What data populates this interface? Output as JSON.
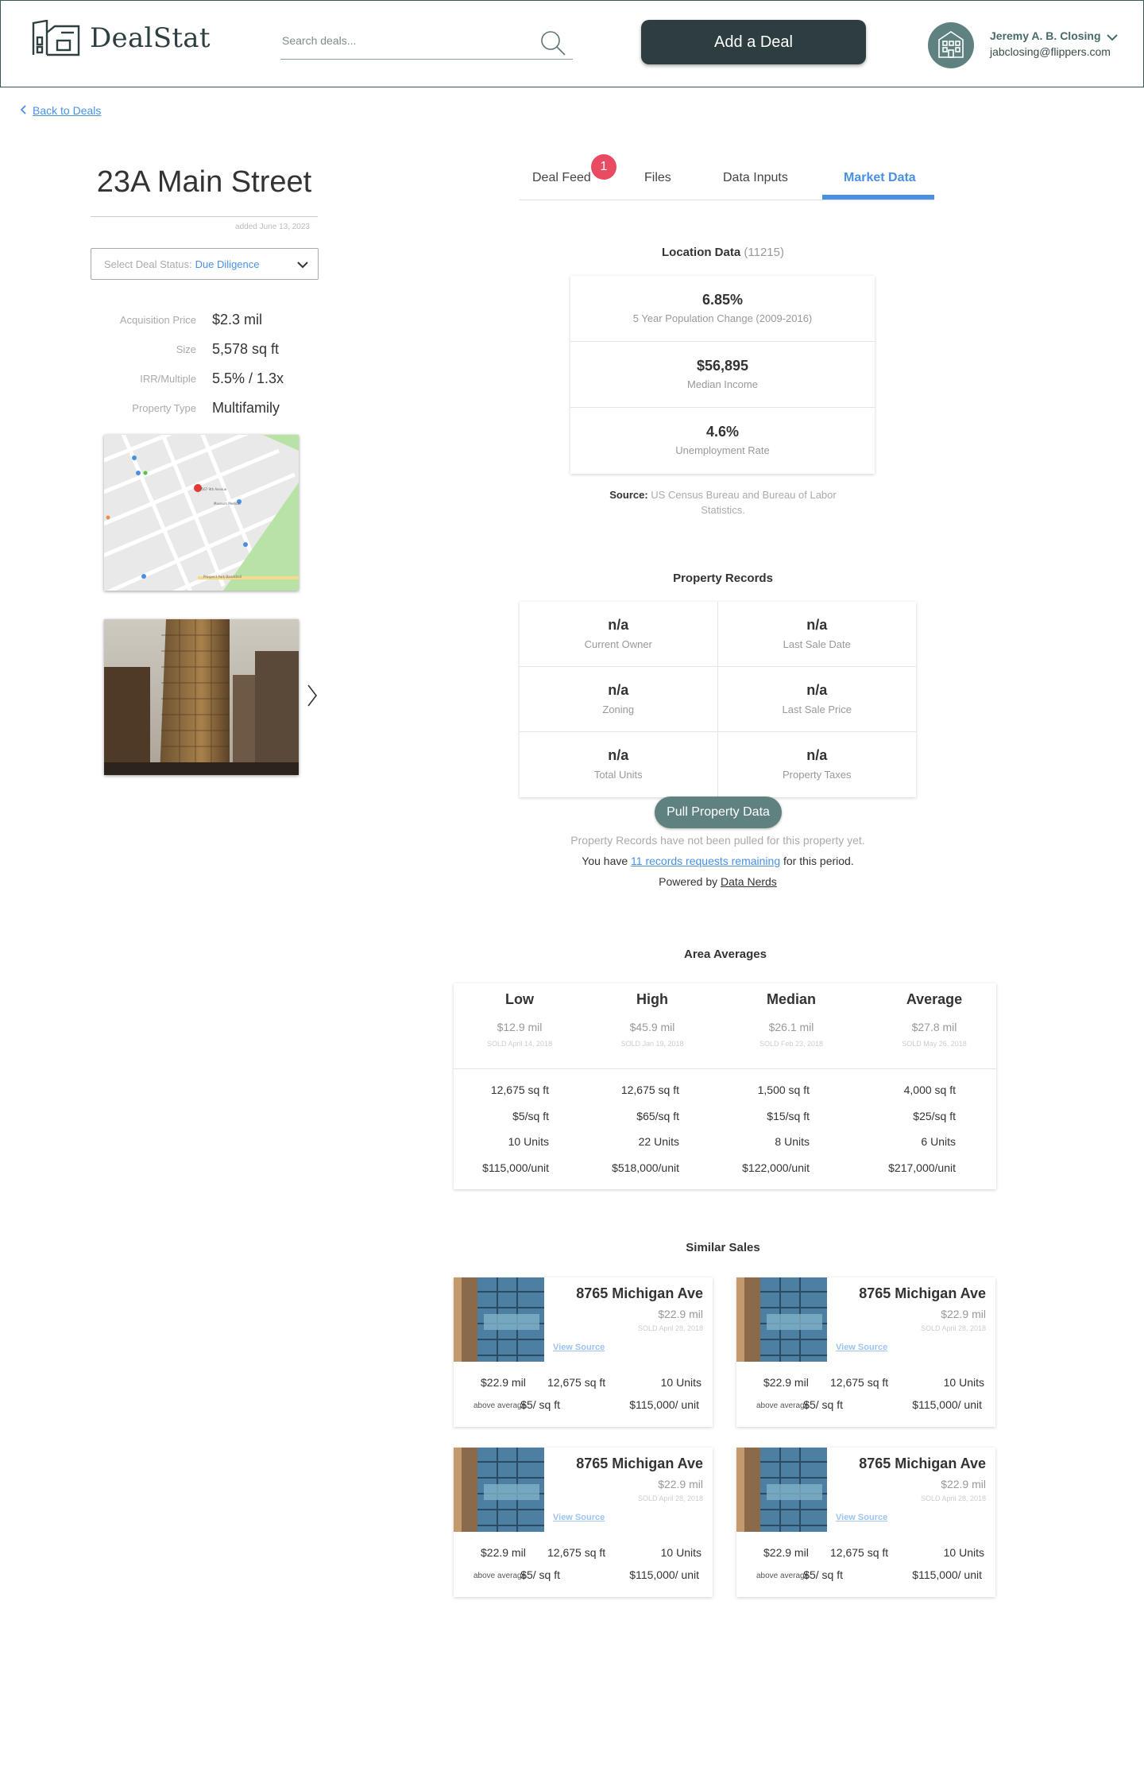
{
  "header": {
    "logo_text": "DealStat",
    "search_placeholder": "Search deals...",
    "add_deal_label": "Add a Deal",
    "user_name": "Jeremy A. B. Closing",
    "user_email": "jabclosing@flippers.com"
  },
  "nav": {
    "back_label": "Back to Deals"
  },
  "deal": {
    "title": "23A Main Street",
    "added": "added June 13, 2023",
    "status_label": "Select Deal Status:",
    "status_value": "Due Diligence",
    "properties": [
      {
        "label": "Acquisition Price",
        "value": "$2.3 mil"
      },
      {
        "label": "Size",
        "value": "5,578 sq ft"
      },
      {
        "label": "IRR/Multiple",
        "value": "5.5% / 1.3x"
      },
      {
        "label": "Property Type",
        "value": "Multifamily"
      }
    ]
  },
  "tabs": [
    {
      "label": "Deal Feed"
    },
    {
      "label": "Files"
    },
    {
      "label": "Data Inputs"
    },
    {
      "label": "Market Data"
    }
  ],
  "deal_feed_badge": "1",
  "location": {
    "title": "Location Data",
    "zip": "(11215)",
    "items": [
      {
        "value": "6.85%",
        "label": "5 Year Population Change (2009-2016)"
      },
      {
        "value": "$56,895",
        "label": "Median Income"
      },
      {
        "value": "4.6%",
        "label": "Unemployment Rate"
      }
    ],
    "source_label": "Source:",
    "source_text": "US Census Bureau and Bureau of Labor Statistics."
  },
  "property_records": {
    "title": "Property Records",
    "cells": [
      {
        "value": "n/a",
        "label": "Current Owner"
      },
      {
        "value": "n/a",
        "label": "Last Sale Date"
      },
      {
        "value": "n/a",
        "label": "Zoning"
      },
      {
        "value": "n/a",
        "label": "Last Sale Price"
      },
      {
        "value": "n/a",
        "label": "Total Units"
      },
      {
        "value": "n/a",
        "label": "Property Taxes"
      }
    ],
    "pull_button": "Pull Property Data",
    "note1": "Property Records have not been pulled for this property yet.",
    "note2_pre": "You have",
    "note2_link": "11 records requests remaining",
    "note2_post": "for this period.",
    "powered_pre": "Powered by",
    "powered_link": "Data Nerds"
  },
  "area_averages": {
    "title": "Area Averages",
    "columns": [
      {
        "head": "Low",
        "price": "$12.9 mil",
        "sold": "SOLD April 14, 2018",
        "sqft": "12,675 sq ft",
        "per_sqft": "$5/sq ft",
        "units": "10 Units",
        "per_unit": "$115,000/unit"
      },
      {
        "head": "High",
        "price": "$45.9 mil",
        "sold": "SOLD Jan 19, 2018",
        "sqft": "12,675 sq ft",
        "per_sqft": "$65/sq ft",
        "units": "22 Units",
        "per_unit": "$518,000/unit"
      },
      {
        "head": "Median",
        "price": "$26.1 mil",
        "sold": "SOLD Feb 23, 2018",
        "sqft": "1,500 sq ft",
        "per_sqft": "$15/sq ft",
        "units": "8 Units",
        "per_unit": "$122,000/unit"
      },
      {
        "head": "Average",
        "price": "$27.8 mil",
        "sold": "SOLD May 26, 2018",
        "sqft": "4,000 sq ft",
        "per_sqft": "$25/sq ft",
        "units": "6 Units",
        "per_unit": "$217,000/unit"
      }
    ]
  },
  "similar_sales": {
    "title": "Similar Sales",
    "cards": [
      {
        "address": "8765 Michigan Ave",
        "price": "$22.9 mil",
        "sold": "SOLD April 28, 2018",
        "link": "View Source",
        "price2": "$22.9 mil",
        "tag": "above average",
        "sqft": "12,675 sq ft",
        "per_sqft": "$5/ sq ft",
        "units": "10 Units",
        "per_unit": "$115,000/ unit"
      },
      {
        "address": "8765 Michigan Ave",
        "price": "$22.9 mil",
        "sold": "SOLD April 28, 2018",
        "link": "View Source",
        "price2": "$22.9 mil",
        "tag": "above average",
        "sqft": "12,675 sq ft",
        "per_sqft": "$5/ sq ft",
        "units": "10 Units",
        "per_unit": "$115,000/ unit"
      },
      {
        "address": "8765 Michigan Ave",
        "price": "$22.9 mil",
        "sold": "SOLD April 28, 2018",
        "link": "View Source",
        "price2": "$22.9 mil",
        "tag": "above average",
        "sqft": "12,675 sq ft",
        "per_sqft": "$5/ sq ft",
        "units": "10 Units",
        "per_unit": "$115,000/ unit"
      },
      {
        "address": "8765 Michigan Ave",
        "price": "$22.9 mil",
        "sold": "SOLD April 28, 2018",
        "link": "View Source",
        "price2": "$22.9 mil",
        "tag": "above average",
        "sqft": "12,675 sq ft",
        "per_sqft": "$5/ sq ft",
        "units": "10 Units",
        "per_unit": "$115,000/ unit"
      }
    ]
  },
  "colors": {
    "brand_dark": "#2d3d40",
    "brand_teal": "#5f8280",
    "accent_blue": "#4a90e2",
    "badge_red": "#e94b62"
  },
  "icons": {
    "logo": "buildings-logo-icon",
    "search": "search-icon",
    "avatar": "building-avatar-icon",
    "user_menu": "chevron-down-icon",
    "back": "chevron-left-icon",
    "status": "chevron-down-icon",
    "photo_next": "chevron-right-icon"
  }
}
